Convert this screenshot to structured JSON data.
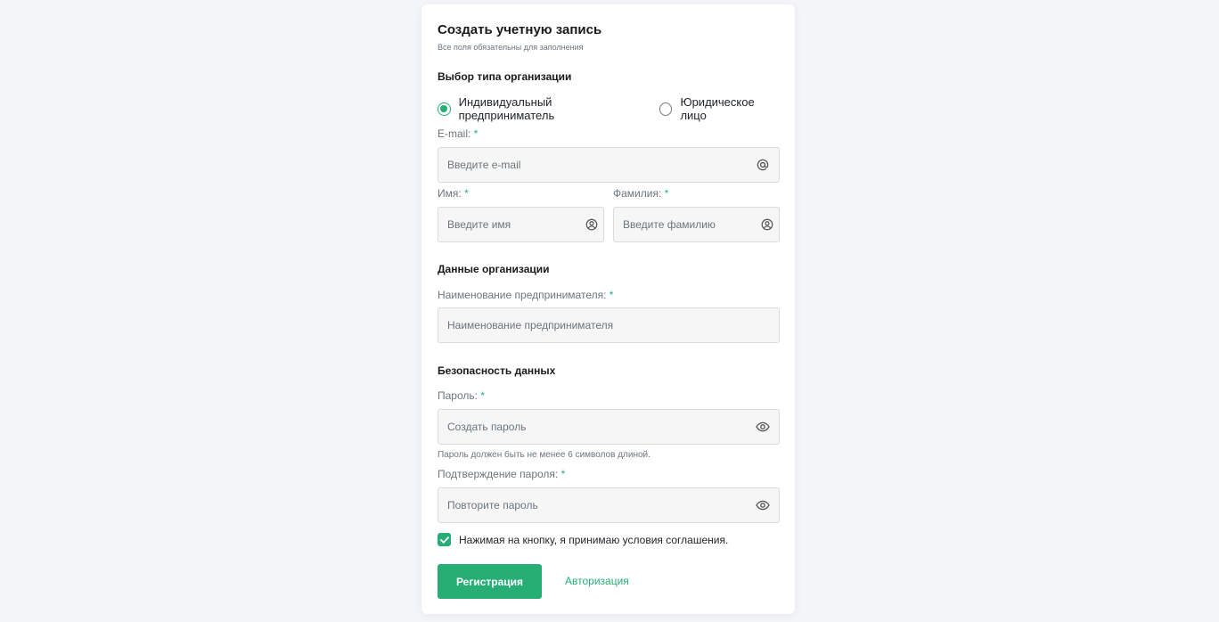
{
  "form": {
    "title": "Создать учетную запись",
    "subtitle": "Все поля обязательны для заполнения",
    "org_type": {
      "heading": "Выбор типа организации",
      "options": [
        {
          "label": "Индивидуальный предприниматель",
          "selected": true
        },
        {
          "label": "Юридическое лицо",
          "selected": false
        }
      ]
    },
    "email": {
      "label": "E-mail:",
      "required_mark": "*",
      "value": "",
      "placeholder": "Введите e-mail",
      "icon": "at-icon"
    },
    "first_name": {
      "label": "Имя:",
      "required_mark": "*",
      "value": "",
      "placeholder": "Введите имя",
      "icon": "user-circle-icon"
    },
    "last_name": {
      "label": "Фамилия:",
      "required_mark": "*",
      "value": "",
      "placeholder": "Введите фамилию",
      "icon": "user-circle-icon"
    },
    "org_data": {
      "heading": "Данные организации",
      "name": {
        "label": "Наименование предпринимателя:",
        "required_mark": "*",
        "value": "",
        "placeholder": "Наименование предпринимателя"
      }
    },
    "security": {
      "heading": "Безопасность данных",
      "password": {
        "label": "Пароль:",
        "required_mark": "*",
        "value": "",
        "placeholder": "Создать пароль",
        "icon": "eye-icon",
        "hint": "Пароль должен быть не менее 6 символов длиной."
      },
      "confirm": {
        "label": "Подтверждение пароля:",
        "required_mark": "*",
        "value": "",
        "placeholder": "Повторите пароль",
        "icon": "eye-icon"
      }
    },
    "agreement": {
      "label": "Нажимая на кнопку, я принимаю условия соглашения.",
      "checked": true
    },
    "submit_label": "Регистрация",
    "login_link": "Авторизация"
  },
  "colors": {
    "accent": "#27ae74",
    "background": "#f4f5f9",
    "field_bg": "#f6f6f6"
  }
}
